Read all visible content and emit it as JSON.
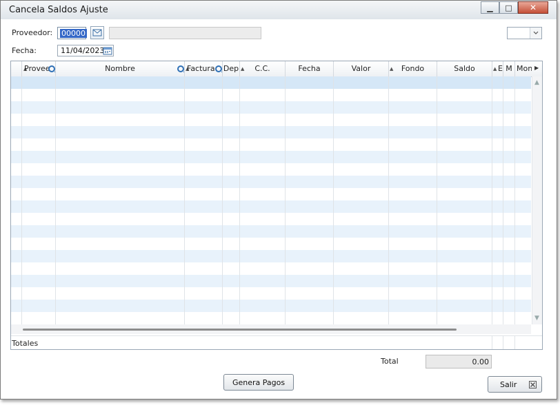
{
  "window": {
    "title": "Cancela Saldos Ajuste",
    "minimize_glyph": "▁",
    "maximize_glyph": "□",
    "close_glyph": "✕"
  },
  "form": {
    "proveedor_label": "Proveedor:",
    "proveedor_code": "00000",
    "proveedor_name": "",
    "fecha_label": "Fecha:",
    "fecha_value": "11/04/2023",
    "combo_value": ""
  },
  "grid": {
    "columns": [
      "Provee",
      "Nombre",
      "Factura",
      "Dep",
      "C.C.",
      "Fecha",
      "Valor",
      "Fondo",
      "Saldo",
      "E",
      "M",
      "Mon"
    ],
    "totals_label": "Totales"
  },
  "footer": {
    "total_label": "Total",
    "total_value": "0.00",
    "genera_label": "Genera Pagos",
    "salir_label": "Salir"
  },
  "colors": {
    "row_stripe": "#e8f2fb",
    "row_selected": "#d5e7f7",
    "accent": "#3367c7"
  },
  "icons": {
    "lookup": "envelope-icon",
    "date": "calendar-icon",
    "search": "magnifier-icon",
    "exit": "close-x-icon"
  }
}
